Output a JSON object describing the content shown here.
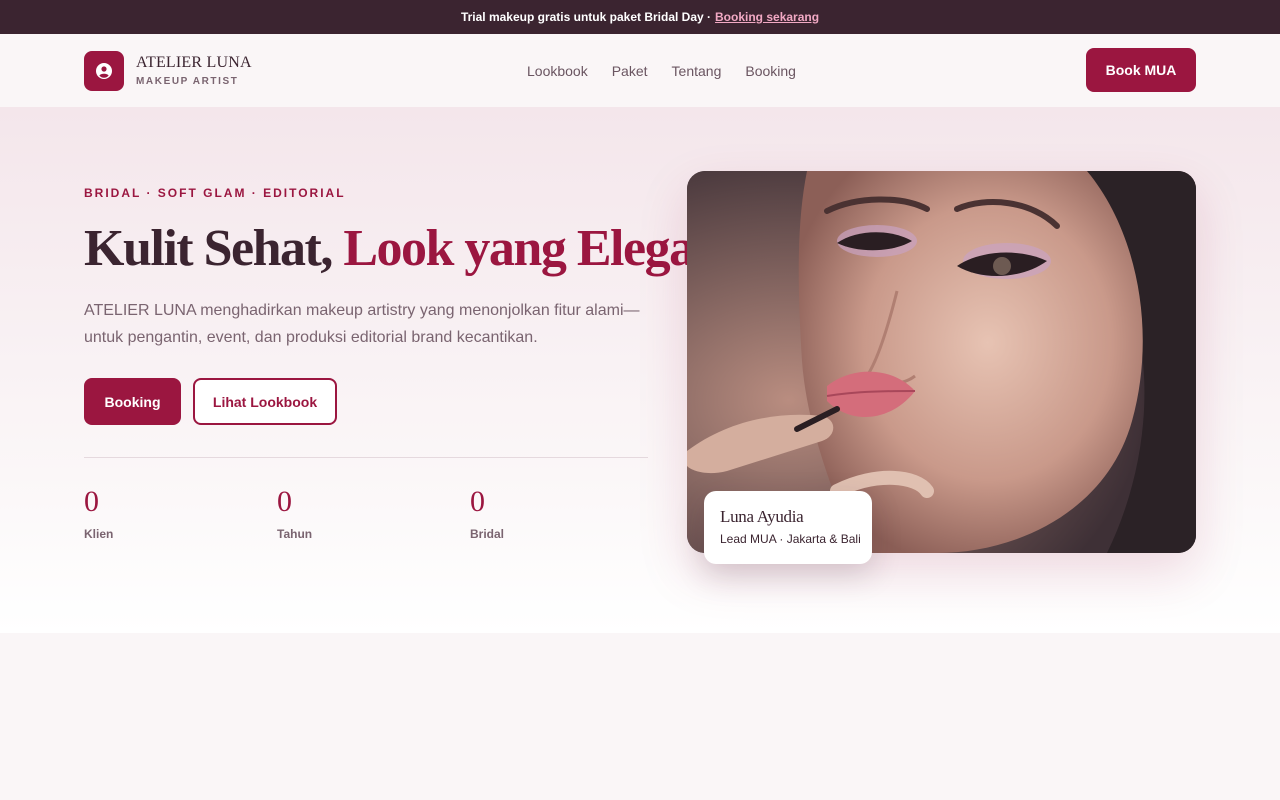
{
  "announcement": {
    "text": "Trial makeup gratis untuk paket Bridal Day ·",
    "link": "Booking sekarang"
  },
  "brand": {
    "name": "ATELIER LUNA",
    "subtitle": "MAKEUP ARTIST",
    "logo_icon": "user-circle-icon"
  },
  "nav": {
    "items": [
      "Lookbook",
      "Paket",
      "Tentang",
      "Booking"
    ],
    "cta": "Book MUA"
  },
  "hero": {
    "eyebrow": "BRIDAL · SOFT GLAM · EDITORIAL",
    "title_plain": "Kulit Sehat, ",
    "title_accent": "Look yang Elegan",
    "lead": "ATELIER LUNA menghadirkan makeup artistry yang menonjolkan fitur alami—untuk pengantin, event, dan produksi editorial brand kecantikan.",
    "primary_cta": "Booking",
    "secondary_cta": "Lihat Lookbook",
    "stats": [
      {
        "value": "0",
        "label": "Klien"
      },
      {
        "value": "0",
        "label": "Tahun"
      },
      {
        "value": "0",
        "label": "Bridal"
      }
    ],
    "photo_card": {
      "name": "Luna Ayudia",
      "role": "Lead MUA · Jakarta & Bali"
    }
  },
  "colors": {
    "brand": "#9b1640",
    "dark": "#3b2430",
    "muted": "#7a6470",
    "link_accent": "#f2a9c4"
  }
}
